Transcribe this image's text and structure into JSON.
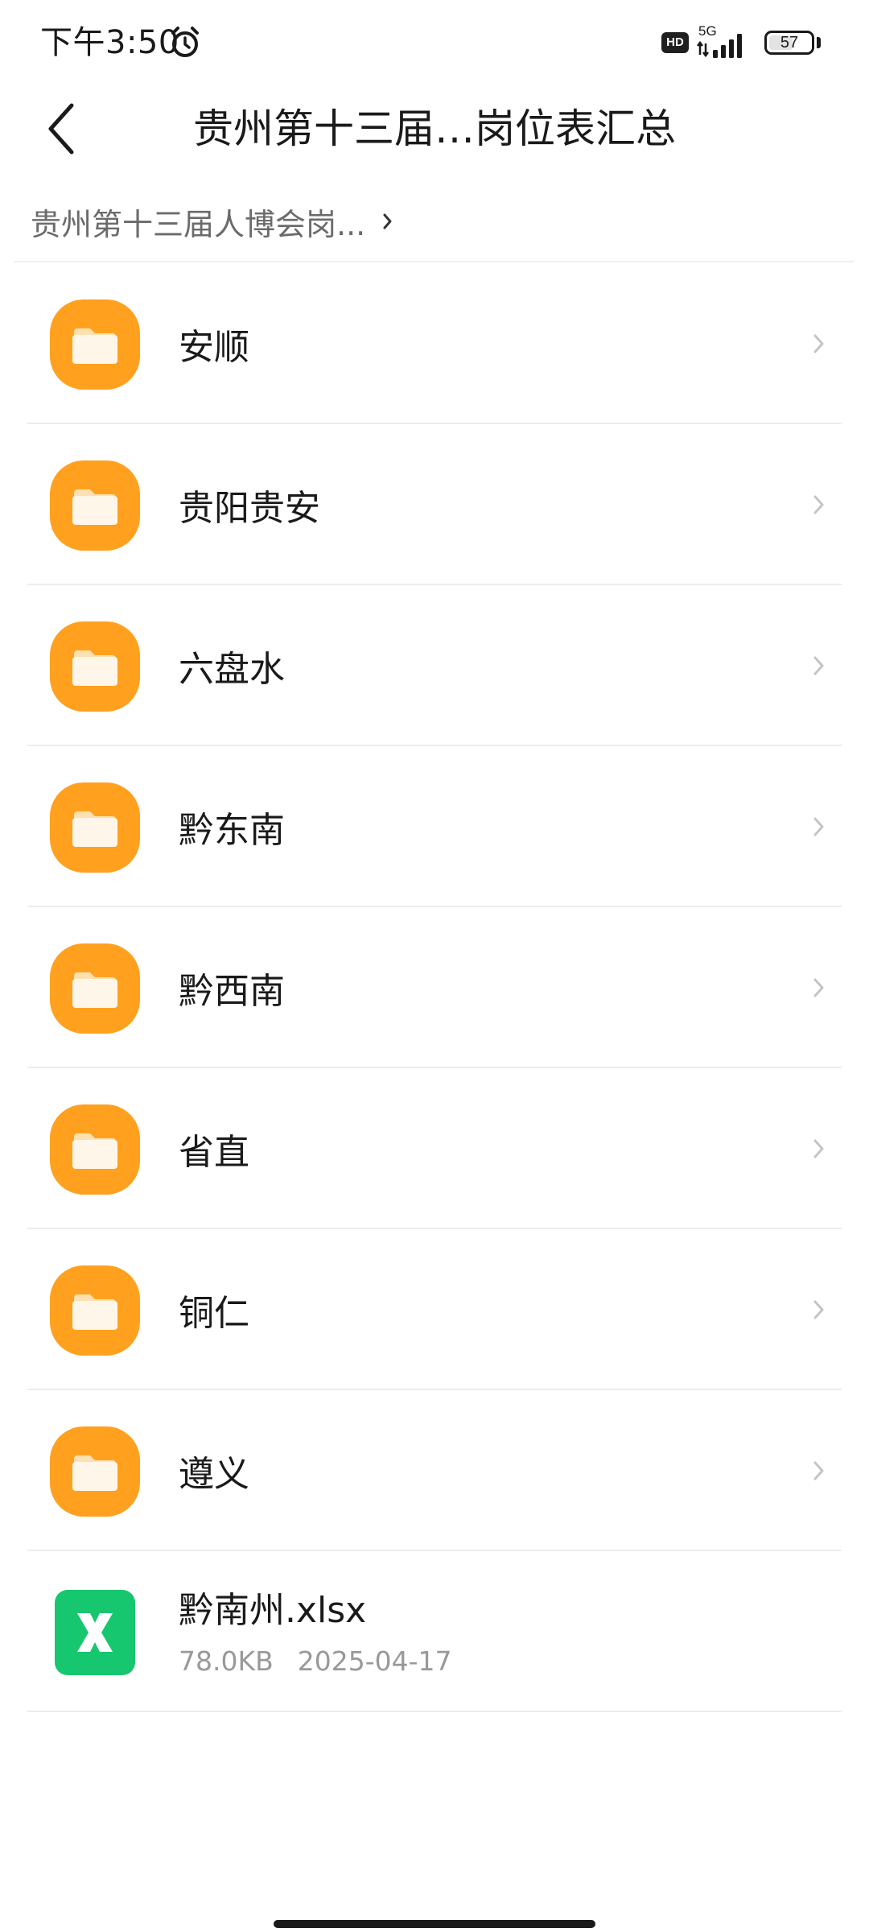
{
  "status_bar": {
    "time": "下午3:50",
    "network_label": "5G",
    "hd_label": "HD",
    "battery_level": "57",
    "battery_fraction": 0.57
  },
  "header": {
    "title": "贵州第十三届…岗位表汇总"
  },
  "breadcrumb": {
    "label": "贵州第十三届人博会岗...",
    "chevron_icon": "chevron-right-icon"
  },
  "colors": {
    "folder": "#ffa11f",
    "xlsx": "#16c76f",
    "text_primary": "#1a1a1a",
    "text_secondary": "#999999"
  },
  "items": [
    {
      "name": "安顺",
      "kind": "folder",
      "icon": "folder-icon"
    },
    {
      "name": "贵阳贵安",
      "kind": "folder",
      "icon": "folder-icon"
    },
    {
      "name": "六盘水",
      "kind": "folder",
      "icon": "folder-icon"
    },
    {
      "name": "黔东南",
      "kind": "folder",
      "icon": "folder-icon"
    },
    {
      "name": "黔西南",
      "kind": "folder",
      "icon": "folder-icon"
    },
    {
      "name": "省直",
      "kind": "folder",
      "icon": "folder-icon"
    },
    {
      "name": "铜仁",
      "kind": "folder",
      "icon": "folder-icon"
    },
    {
      "name": "遵义",
      "kind": "folder",
      "icon": "folder-icon"
    },
    {
      "name": "黔南州.xlsx",
      "kind": "file",
      "icon": "excel-file-icon",
      "size": "78.0KB",
      "date": "2025-04-17"
    }
  ]
}
